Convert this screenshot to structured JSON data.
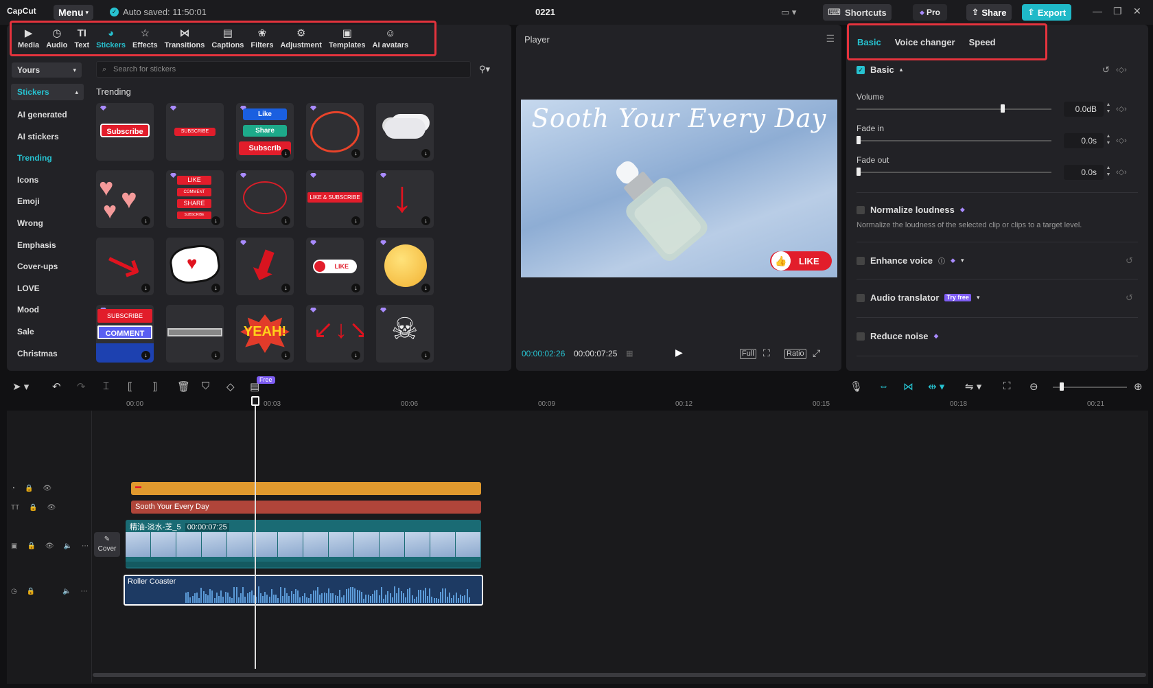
{
  "titlebar": {
    "logo": "CapCut",
    "menu_label": "Menu",
    "autosave": "Auto saved: 11:50:01",
    "project_title": "0221",
    "shortcuts": "Shortcuts",
    "pro": "Pro",
    "share": "Share",
    "export": "Export"
  },
  "tool_tabs": [
    {
      "label": "Media",
      "icon": "media-icon"
    },
    {
      "label": "Audio",
      "icon": "audio-icon"
    },
    {
      "label": "Text",
      "icon": "text-icon"
    },
    {
      "label": "Stickers",
      "icon": "stickers-icon"
    },
    {
      "label": "Effects",
      "icon": "effects-icon"
    },
    {
      "label": "Transitions",
      "icon": "transitions-icon"
    },
    {
      "label": "Captions",
      "icon": "captions-icon"
    },
    {
      "label": "Filters",
      "icon": "filters-icon"
    },
    {
      "label": "Adjustment",
      "icon": "adjustment-icon"
    },
    {
      "label": "Templates",
      "icon": "templates-icon"
    },
    {
      "label": "AI avatars",
      "icon": "ai-avatars-icon"
    }
  ],
  "stickers_panel": {
    "dropdown": "Yours",
    "search_placeholder": "Search for stickers",
    "section_title": "Trending",
    "categories": [
      "Stickers",
      "AI generated",
      "AI stickers",
      "Trending",
      "Icons",
      "Emoji",
      "Wrong",
      "Emphasis",
      "Cover-ups",
      "LOVE",
      "Mood",
      "Sale",
      "Christmas"
    ],
    "sticker_texts": {
      "subscribe1": "Subscribe",
      "subscribe2": "SUBSCRIBE",
      "like": "Like",
      "share": "Share",
      "subscribe3": "Subscrib",
      "like_btn": "LIKE",
      "comment": "COMMENT",
      "share_btn": "SHARE",
      "subscribe_small": "SUBSCRIBE",
      "like_subscribe": "LIKE & SUBSCRIBE",
      "like_pill": "LIKE",
      "subscribe4": "SUBSCRIBE",
      "comment2": "COMMENT",
      "yeah": "YEAH!"
    }
  },
  "player": {
    "title": "Player",
    "video_title": "Sooth Your Every Day",
    "like_badge": "LIKE",
    "current_time": "00:00:02:26",
    "total_time": "00:00:07:25",
    "buttons": [
      "Full",
      "Ratio"
    ]
  },
  "right_panel": {
    "tabs": [
      "Basic",
      "Voice changer",
      "Speed"
    ],
    "section": "Basic",
    "volume_label": "Volume",
    "volume_value": "0.0dB",
    "volume_level": 0.75,
    "fade_in_label": "Fade in",
    "fade_in_value": "0.0s",
    "fade_out_label": "Fade out",
    "fade_out_value": "0.0s",
    "normalize_label": "Normalize loudness",
    "normalize_desc": "Normalize the loudness of the selected clip or clips to a target level.",
    "enhance_label": "Enhance voice",
    "translator_label": "Audio translator",
    "try_free": "Try free",
    "noise_label": "Reduce noise"
  },
  "timeline": {
    "free_badge": "Free",
    "ruler": [
      "00:00",
      "00:03",
      "00:06",
      "00:09",
      "00:12",
      "00:15",
      "00:18",
      "00:21"
    ],
    "text_clip": "Sooth Your Every Day",
    "video_clip_name": "精油-淡水-芝_5",
    "video_clip_duration": "00:00:07:25",
    "audio_clip": "Roller Coaster",
    "cover_label": "Cover"
  },
  "colors": {
    "accent": "#27c2d0",
    "highlight_border": "#e5333d",
    "sticker_track": "#e0992e",
    "text_track": "#b0453a",
    "video_track": "#1a6b74",
    "audio_track": "#1d3a63"
  }
}
